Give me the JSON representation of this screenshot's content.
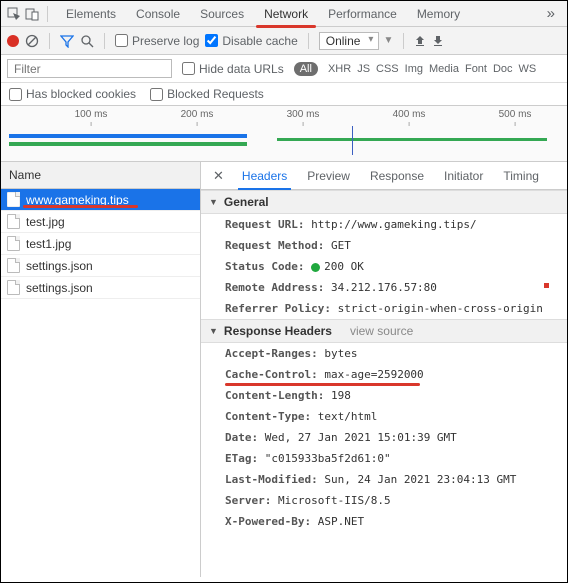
{
  "main_tabs": [
    "Elements",
    "Console",
    "Sources",
    "Network",
    "Performance",
    "Memory"
  ],
  "active_main_tab": 3,
  "toolbar": {
    "preserve": "Preserve log",
    "disable": "Disable cache",
    "throttle": "Online"
  },
  "filter": {
    "placeholder": "Filter",
    "hide_urls": "Hide data URLs",
    "all": "All",
    "types": [
      "XHR",
      "JS",
      "CSS",
      "Img",
      "Media",
      "Font",
      "Doc",
      "WS"
    ],
    "blocked_cookies": "Has blocked cookies",
    "blocked_requests": "Blocked Requests"
  },
  "timeline": {
    "ticks": [
      "100 ms",
      "200 ms",
      "300 ms",
      "400 ms",
      "500 ms"
    ]
  },
  "name_header": "Name",
  "requests": [
    "www.gameking.tips",
    "test.jpg",
    "test1.jpg",
    "settings.json",
    "settings.json"
  ],
  "active_request": 0,
  "detail_tabs": [
    "Headers",
    "Preview",
    "Response",
    "Initiator",
    "Timing"
  ],
  "active_detail_tab": 0,
  "sections": {
    "general": "General",
    "response": "Response Headers",
    "view_source": "view source"
  },
  "general": {
    "url_k": "Request URL:",
    "url_v": "http://www.gameking.tips/",
    "method_k": "Request Method:",
    "method_v": "GET",
    "status_k": "Status Code:",
    "status_v": "200 OK",
    "remote_k": "Remote Address:",
    "remote_v": "34.212.176.57:80",
    "referrer_k": "Referrer Policy:",
    "referrer_v": "strict-origin-when-cross-origin"
  },
  "response_headers": [
    {
      "k": "Accept-Ranges:",
      "v": "bytes"
    },
    {
      "k": "Cache-Control:",
      "v": "max-age=2592000"
    },
    {
      "k": "Content-Length:",
      "v": "198"
    },
    {
      "k": "Content-Type:",
      "v": "text/html"
    },
    {
      "k": "Date:",
      "v": "Wed, 27 Jan 2021 15:01:39 GMT"
    },
    {
      "k": "ETag:",
      "v": "\"c015933ba5f2d61:0\""
    },
    {
      "k": "Last-Modified:",
      "v": "Sun, 24 Jan 2021 23:04:13 GMT"
    },
    {
      "k": "Server:",
      "v": "Microsoft-IIS/8.5"
    },
    {
      "k": "X-Powered-By:",
      "v": "ASP.NET"
    }
  ],
  "highlight_header_index": 1
}
